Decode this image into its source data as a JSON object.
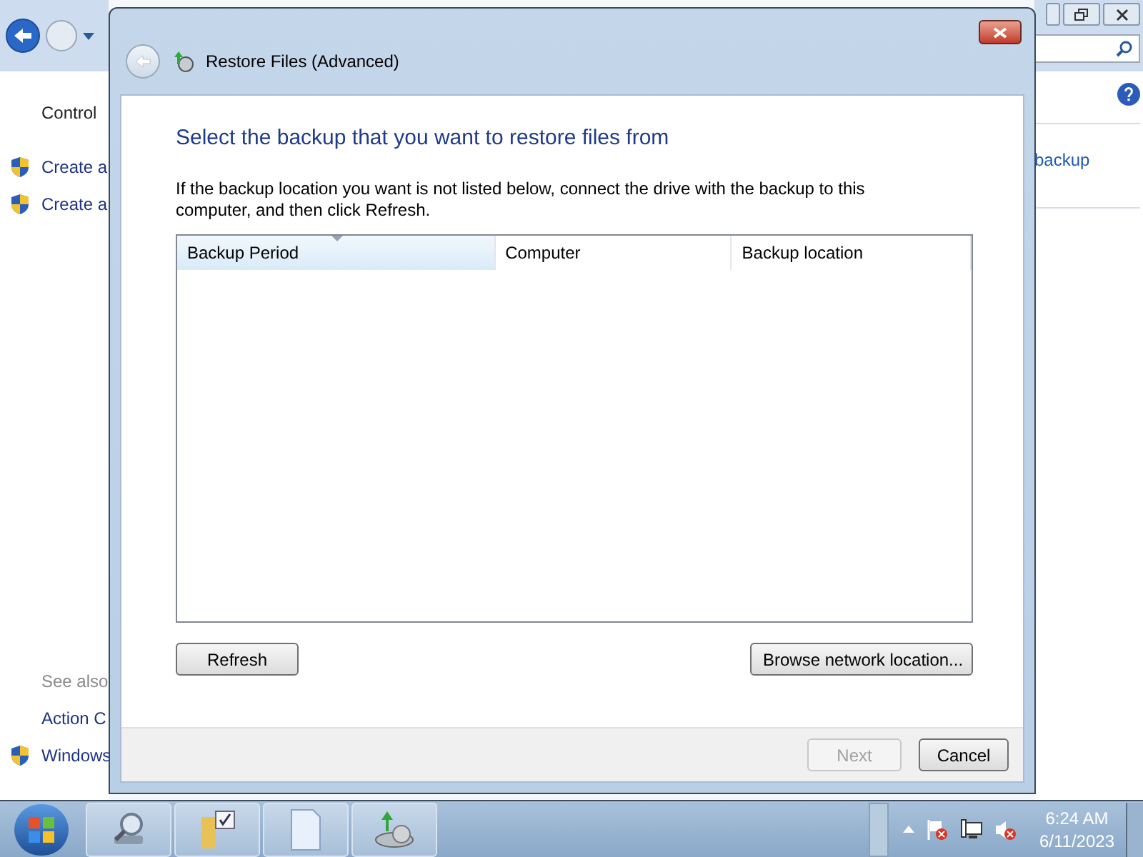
{
  "background_window": {
    "breadcrumb": "Control",
    "tasks": [
      "Create a",
      "Create a"
    ],
    "see_also_heading": "See also",
    "see_also": [
      {
        "label": "Action C",
        "kind": "plain"
      },
      {
        "label": "Windows",
        "kind": "shield"
      }
    ],
    "right_link": "backup"
  },
  "dialog": {
    "title": "Restore Files (Advanced)",
    "heading": "Select the backup that you want to restore files from",
    "description": "If the backup location you want is not listed below, connect the drive with the backup to this computer, and then click Refresh.",
    "table": {
      "columns": [
        {
          "label": "Backup Period",
          "selected": true
        },
        {
          "label": "Computer",
          "selected": false
        },
        {
          "label": "Backup location",
          "selected": false
        }
      ]
    },
    "buttons": [
      {
        "label": "Refresh",
        "disabled": false
      },
      {
        "label": "Browse network location...",
        "disabled": false
      }
    ],
    "footer_buttons": [
      {
        "label": "Next",
        "disabled": true
      },
      {
        "label": "Cancel",
        "disabled": false
      }
    ]
  },
  "taskbar": {
    "items": [
      {
        "kind": "search"
      },
      {
        "kind": "folder"
      },
      {
        "kind": "document"
      },
      {
        "kind": "backup"
      }
    ],
    "time": "6:24 AM",
    "date": "6/11/2023"
  }
}
